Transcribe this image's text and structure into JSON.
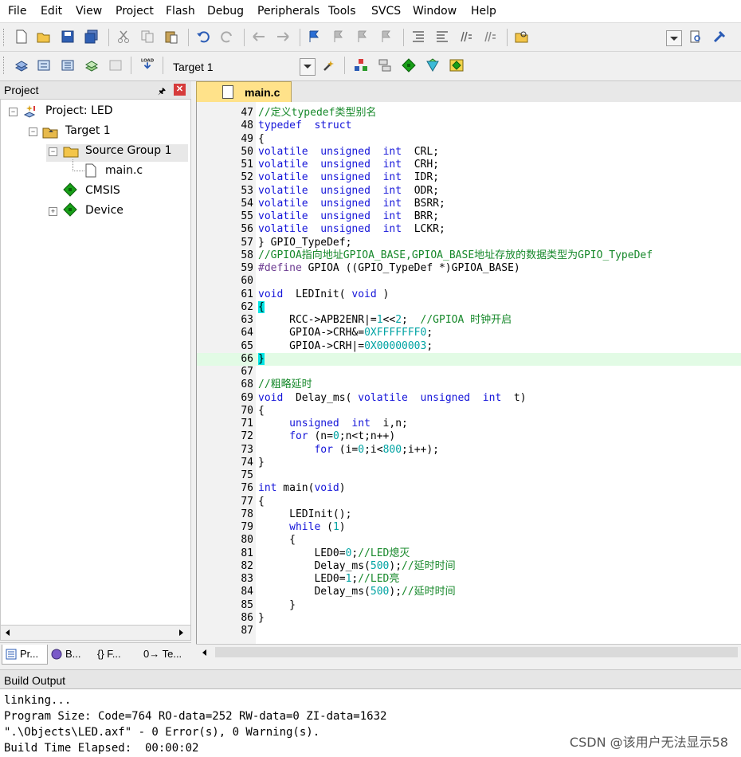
{
  "menu": {
    "items": [
      "File",
      "Edit",
      "View",
      "Project",
      "Flash",
      "Debug",
      "Peripherals",
      "Tools",
      "SVCS",
      "Window",
      "Help"
    ]
  },
  "toolbar": {
    "target_name": "Target 1"
  },
  "project_pane": {
    "title": "Project",
    "tree": {
      "project": "Project: LED",
      "target": "Target 1",
      "group": "Source Group 1",
      "file": "main.c",
      "cmsis": "CMSIS",
      "device": "Device"
    },
    "tabs": [
      "Pr...",
      "B...",
      "{} F...",
      "0→ Te..."
    ]
  },
  "editor": {
    "tab_label": "main.c",
    "current_line": "66",
    "lines": [
      {
        "n": "47",
        "t": "//定义typedef类型别名"
      },
      {
        "n": "48",
        "t": "typedef  struct"
      },
      {
        "n": "49",
        "t": "{"
      },
      {
        "n": "50",
        "t": "volatile  unsigned  int  CRL;"
      },
      {
        "n": "51",
        "t": "volatile  unsigned  int  CRH;"
      },
      {
        "n": "52",
        "t": "volatile  unsigned  int  IDR;"
      },
      {
        "n": "53",
        "t": "volatile  unsigned  int  ODR;"
      },
      {
        "n": "54",
        "t": "volatile  unsigned  int  BSRR;"
      },
      {
        "n": "55",
        "t": "volatile  unsigned  int  BRR;"
      },
      {
        "n": "56",
        "t": "volatile  unsigned  int  LCKR;"
      },
      {
        "n": "57",
        "t": "} GPIO_TypeDef;"
      },
      {
        "n": "58",
        "t": "//GPIOA指向地址GPIOA_BASE,GPIOA_BASE地址存放的数据类型为GPIO_TypeDef"
      },
      {
        "n": "59",
        "t": "#define GPIOA ((GPIO_TypeDef *)GPIOA_BASE)"
      },
      {
        "n": "60",
        "t": ""
      },
      {
        "n": "61",
        "t": "void  LEDInit( void )"
      },
      {
        "n": "62",
        "t": "{"
      },
      {
        "n": "63",
        "t": "     RCC->APB2ENR|=1<<2;  //GPIOA 时钟开启"
      },
      {
        "n": "64",
        "t": "     GPIOA->CRH&=0XFFFFFFF0;"
      },
      {
        "n": "65",
        "t": "     GPIOA->CRH|=0X00000003;"
      },
      {
        "n": "66",
        "t": "}"
      },
      {
        "n": "67",
        "t": ""
      },
      {
        "n": "68",
        "t": "//粗略延时"
      },
      {
        "n": "69",
        "t": "void  Delay_ms( volatile  unsigned  int  t)"
      },
      {
        "n": "70",
        "t": "{"
      },
      {
        "n": "71",
        "t": "     unsigned  int  i,n;"
      },
      {
        "n": "72",
        "t": "     for (n=0;n<t;n++)"
      },
      {
        "n": "73",
        "t": "         for (i=0;i<800;i++);"
      },
      {
        "n": "74",
        "t": "}"
      },
      {
        "n": "75",
        "t": ""
      },
      {
        "n": "76",
        "t": "int main(void)"
      },
      {
        "n": "77",
        "t": "{"
      },
      {
        "n": "78",
        "t": "     LEDInit();"
      },
      {
        "n": "79",
        "t": "     while (1)"
      },
      {
        "n": "80",
        "t": "     {"
      },
      {
        "n": "81",
        "t": "         LED0=0;//LED熄灭"
      },
      {
        "n": "82",
        "t": "         Delay_ms(500);//延时时间"
      },
      {
        "n": "83",
        "t": "         LED0=1;//LED亮"
      },
      {
        "n": "84",
        "t": "         Delay_ms(500);//延时时间"
      },
      {
        "n": "85",
        "t": "     }"
      },
      {
        "n": "86",
        "t": "}"
      },
      {
        "n": "87",
        "t": ""
      }
    ]
  },
  "build_output": {
    "title": "Build Output",
    "lines": [
      "linking...",
      "Program Size: Code=764 RO-data=252 RW-data=0 ZI-data=1632",
      "\".\\Objects\\LED.axf\" - 0 Error(s), 0 Warning(s).",
      "Build Time Elapsed:  00:00:02"
    ]
  },
  "watermark": "CSDN @该用户无法显示58",
  "colors": {
    "keyword": "#1515d9",
    "comment": "#16882a",
    "number": "#00a3a3",
    "preprocessor": "#6b3a90",
    "current_line_bg": "#e2fbe5",
    "tab_active_bg": "#ffe28a"
  }
}
